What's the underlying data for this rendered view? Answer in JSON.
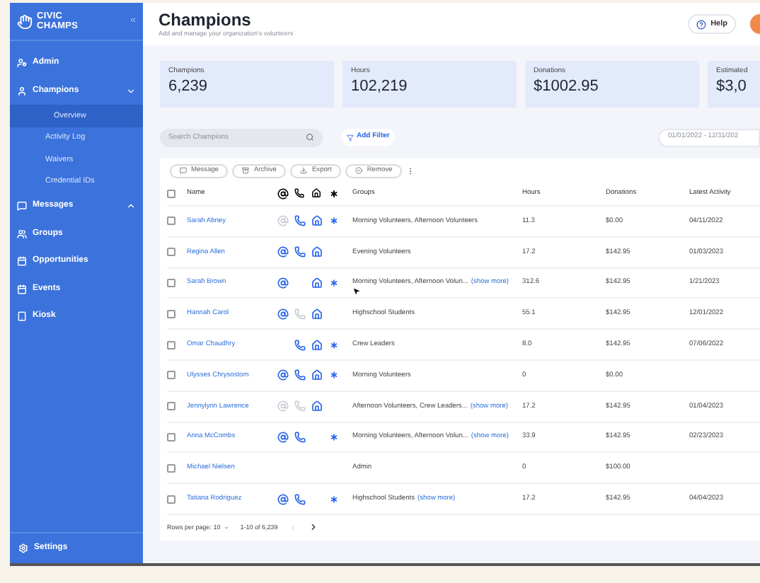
{
  "sidebar": {
    "logo": [
      "CIVIC",
      "CHAMPS"
    ],
    "collapse": "«",
    "items": [
      {
        "label": "Admin"
      },
      {
        "label": "Champions",
        "expanded": true,
        "children": [
          {
            "label": "Overview",
            "selected": true
          },
          {
            "label": "Activity Log",
            "selected": false
          },
          {
            "label": "Waivers",
            "selected": false
          },
          {
            "label": "Credential IDs",
            "selected": false
          }
        ]
      },
      {
        "label": "Messages",
        "expanded": false
      },
      {
        "label": "Groups"
      },
      {
        "label": "Opportunities"
      },
      {
        "label": "Events"
      },
      {
        "label": "Kiosk"
      }
    ],
    "footer": "Settings"
  },
  "header": {
    "title": "Champions",
    "subtitle": "Add and manage your organization's volunteers",
    "help": "Help"
  },
  "stats": [
    {
      "label": "Champions",
      "value": "6,239"
    },
    {
      "label": "Hours",
      "value": "102,219"
    },
    {
      "label": "Donations",
      "value": "$1002.95"
    },
    {
      "label": "Estimated",
      "value": "$3,0"
    }
  ],
  "search": {
    "placeholder": "Search Champions"
  },
  "add_filter": "Add Filter",
  "date_range": "01/01/2022 - 12/31/202",
  "actions": [
    {
      "label": "Message"
    },
    {
      "label": "Archive"
    },
    {
      "label": "Export"
    },
    {
      "label": "Remove"
    }
  ],
  "table": {
    "select_all_checked": false,
    "columns": [
      "Name",
      "Groups",
      "Hours",
      "Donations",
      "Latest Activity"
    ],
    "rows": [
      {
        "checked": false,
        "name": "Sarah Abney",
        "contacts": [
          {
            "kind": "email",
            "active": false
          },
          {
            "kind": "phone",
            "active": true
          },
          {
            "kind": "home",
            "active": true
          },
          {
            "kind": "other",
            "active": true
          }
        ],
        "groups": [
          {
            "kind": "text",
            "text": "Morning Volunteers, Afternoon Volunteers"
          }
        ],
        "hours": "11.3",
        "donations": "$0.00",
        "latest_activity": "04/11/2022"
      },
      {
        "checked": false,
        "name": "Regina Allen",
        "contacts": [
          {
            "kind": "email",
            "active": true
          },
          {
            "kind": "phone",
            "active": true
          },
          {
            "kind": "home",
            "active": true
          }
        ],
        "groups": [
          {
            "kind": "text",
            "text": "Evening Volunteers"
          }
        ],
        "hours": "17.2",
        "donations": "$142.95",
        "latest_activity": "01/03/2023"
      },
      {
        "checked": false,
        "name": "Sarah Brown",
        "contacts": [
          {
            "kind": "email",
            "active": true
          },
          {
            "kind": "home",
            "active": true
          },
          {
            "kind": "other",
            "active": true
          }
        ],
        "groups": [
          {
            "kind": "text",
            "text": "Morning Volunteers, Afternoon Volun..."
          },
          {
            "kind": "link",
            "text": "(show more)"
          }
        ],
        "hours": "312.6",
        "donations": "$142.95",
        "latest_activity": "1/21/2023"
      },
      {
        "checked": false,
        "name": "Hannah Carol",
        "contacts": [
          {
            "kind": "email",
            "active": true
          },
          {
            "kind": "phone",
            "active": false
          },
          {
            "kind": "home",
            "active": true
          }
        ],
        "groups": [
          {
            "kind": "text",
            "text": "Highschool Students"
          }
        ],
        "hours": "55.1",
        "donations": "$142.95",
        "latest_activity": "12/01/2022"
      },
      {
        "checked": false,
        "name": "Omar Chaudhry",
        "contacts": [
          {
            "kind": "phone",
            "active": true
          },
          {
            "kind": "home",
            "active": true
          },
          {
            "kind": "other",
            "active": true
          }
        ],
        "groups": [
          {
            "kind": "text",
            "text": "Crew Leaders"
          }
        ],
        "hours": "8.0",
        "donations": "$142.95",
        "latest_activity": "07/06/2022"
      },
      {
        "checked": false,
        "name": "Ulysses Chrysostom",
        "contacts": [
          {
            "kind": "email",
            "active": true
          },
          {
            "kind": "phone",
            "active": true
          },
          {
            "kind": "home",
            "active": true
          },
          {
            "kind": "other",
            "active": true
          }
        ],
        "groups": [
          {
            "kind": "text",
            "text": "Morning Volunteers"
          }
        ],
        "hours": "0",
        "donations": "$0.00"
      },
      {
        "checked": false,
        "name": "Jennylynn Lawrence",
        "contacts": [
          {
            "kind": "email",
            "active": false
          },
          {
            "kind": "phone",
            "active": false
          },
          {
            "kind": "home",
            "active": true
          }
        ],
        "groups": [
          {
            "kind": "text",
            "text": "Afternoon Volunteers, Crew Leaders..."
          },
          {
            "kind": "link",
            "text": "(show more)"
          }
        ],
        "hours": "17.2",
        "donations": "$142.95",
        "latest_activity": "01/04/2023"
      },
      {
        "checked": false,
        "name": "Anna McCombs",
        "contacts": [
          {
            "kind": "email",
            "active": true
          },
          {
            "kind": "phone",
            "active": true
          },
          {
            "kind": "other",
            "active": true
          }
        ],
        "groups": [
          {
            "kind": "text",
            "text": "Morning Volunteers, Afternoon Volun..."
          },
          {
            "kind": "link",
            "text": "(show more)"
          }
        ],
        "hours": "33.9",
        "donations": "$142.95",
        "latest_activity": "02/23/2023"
      },
      {
        "checked": false,
        "name": "Michael Nielsen",
        "groups": [
          {
            "kind": "text",
            "text": "Admin"
          }
        ],
        "hours": "0",
        "donations": "$100.00"
      },
      {
        "checked": false,
        "name": "Tatiana Rodriguez",
        "contacts": [
          {
            "kind": "email",
            "active": true
          },
          {
            "kind": "phone",
            "active": true
          },
          {
            "kind": "other",
            "active": true
          }
        ],
        "groups": [
          {
            "kind": "text",
            "text": "Highschool Students"
          },
          {
            "kind": "link",
            "text": "(show more)"
          }
        ],
        "hours": "17.2",
        "donations": "$142.95",
        "latest_activity": "04/04/2023"
      }
    ]
  },
  "pagination": {
    "rows_per_page": "Rows per page: 10",
    "range": "1-10 of 6,239"
  }
}
